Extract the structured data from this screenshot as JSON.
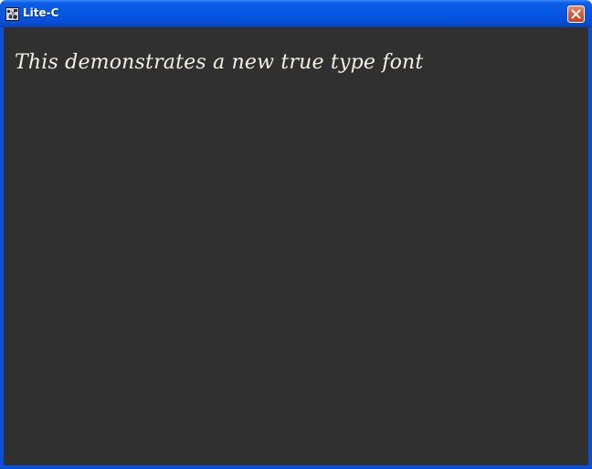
{
  "window": {
    "title": "Lite-C",
    "icons": {
      "app": "lite-c-app-icon",
      "close": "close-icon"
    }
  },
  "content": {
    "demo_text": "This demonstrates a new true type font"
  },
  "colors": {
    "titlebar": "#0658e3",
    "client_background": "#303030",
    "text": "#f4f1e4",
    "close_button": "#dc5a34"
  }
}
